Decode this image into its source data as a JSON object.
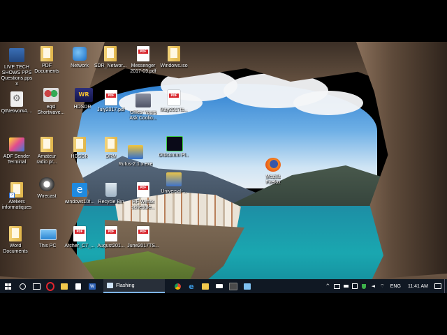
{
  "desktop_icons": [
    {
      "label": "LIVE TECH\nSHOWS PPS\nQuestions.pps\nx"
    },
    {
      "label": "PDF\nDocuments"
    },
    {
      "label": "Network"
    },
    {
      "label": "SDR_Networ..."
    },
    {
      "label": "Messenger\n2017-09.pdf"
    },
    {
      "label": "Windows.iso"
    },
    {
      "label": "QtNetwork4...."
    },
    {
      "label": "eqsl\nShortwave..."
    },
    {
      "label": "HDSDR"
    },
    {
      "label": "July2017.pdf"
    },
    {
      "label": "Gilles' Yours\nAsk Coolio..."
    },
    {
      "label": "May2017ts..."
    },
    {
      "label": "ADF Sender\nTerminal"
    },
    {
      "label": "Amateur\nradio pr..."
    },
    {
      "label": "HDSDR"
    },
    {
      "label": "DRM"
    },
    {
      "label": "Rufus-2.1.x.exe"
    },
    {
      "label": "Orbcomm Pl..."
    },
    {
      "label": "Ateliers\ninformatiques"
    },
    {
      "label": "Wirecast"
    },
    {
      "label": "windows10f..."
    },
    {
      "label": "Recycle Bin"
    },
    {
      "label": "HF Wefax\nschedule..."
    },
    {
      "label": "Universal-..."
    },
    {
      "label": "Mozilla\nFirefox"
    },
    {
      "label": "Word\nDocuments"
    },
    {
      "label": "This PC"
    },
    {
      "label": "Archer_C7_..."
    },
    {
      "label": "August201..."
    },
    {
      "label": "June2017TS..."
    }
  ],
  "taskbar": {
    "active_task": "Flashing",
    "language": "ENG",
    "time": "11:41 AM"
  }
}
